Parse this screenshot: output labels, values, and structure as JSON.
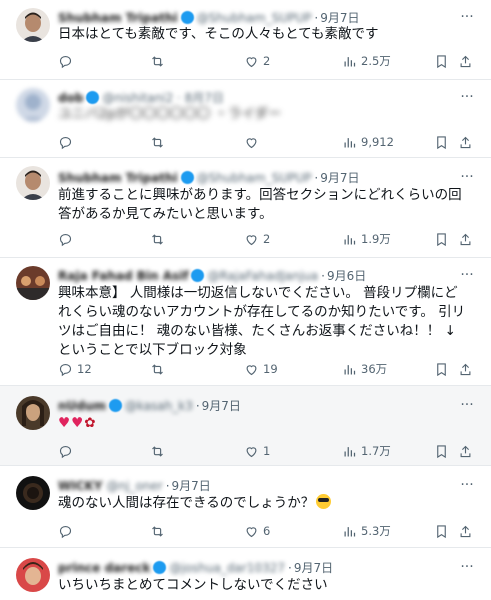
{
  "tweets": [
    {
      "name": "Shubham Tripathi",
      "handle": "@Shubham_SUPUP",
      "date": "9月7日",
      "text": "日本はとても素敵です、そこの人々もとても素敵です",
      "replies": "",
      "retweets": "",
      "likes": "2",
      "views": "2.5万"
    },
    {
      "name": "dob",
      "handle": "@nishitani2 · 8月7日",
      "date": "",
      "text": "ユニバ2pが〇〇〇〇〇〇 ・ライダー",
      "replies": "",
      "retweets": "",
      "likes": "",
      "views": "9,912"
    },
    {
      "name": "Shubham Tripathi",
      "handle": "@Shubham_SUPUP",
      "date": "9月7日",
      "text": "前進することに興味があります。回答セクションにどれくらいの回答があるか見てみたいと思います。",
      "replies": "",
      "retweets": "",
      "likes": "2",
      "views": "1.9万"
    },
    {
      "name": "Raja Fahad Bin Asif",
      "handle": "@RajaFahadJanjua",
      "date": "9月6日",
      "text": "興味本意】 人間様は一切返信しないでください。 普段リプ欄にどれくらい魂のないアカウントが存在してるのか知りたいです。 引リツはご自由に！ 魂のない皆様、たくさんお返事くださいね！！ ↓ということで以下ブロック対象",
      "replies": "12",
      "retweets": "",
      "likes": "19",
      "views": "36万"
    },
    {
      "name": "nUdum",
      "handle": "@kasah_k3",
      "date": "9月7日",
      "text": "",
      "replies": "",
      "retweets": "",
      "likes": "1",
      "views": "1.7万"
    },
    {
      "name": "WICKY",
      "handle": "@nj_oner",
      "date": "9月7日",
      "text": "魂のない人間は存在できるのでしょうか？",
      "replies": "",
      "retweets": "",
      "likes": "6",
      "views": "5.3万"
    },
    {
      "name": "prince dareck",
      "handle": "@joshua_dar10327",
      "date": "9月7日",
      "text": "いちいちまとめてコメントしないでください",
      "replies": "",
      "retweets": "",
      "likes": "",
      "views": ""
    }
  ],
  "colors": {
    "accent": "#1d9bf0",
    "muted": "#536471",
    "heart": "#e0245e",
    "divider": "#e6e9ec"
  },
  "icons": [
    "reply-icon",
    "retweet-icon",
    "like-icon",
    "views-icon",
    "bookmark-icon",
    "share-icon",
    "more-icon",
    "verified-badge-icon"
  ]
}
